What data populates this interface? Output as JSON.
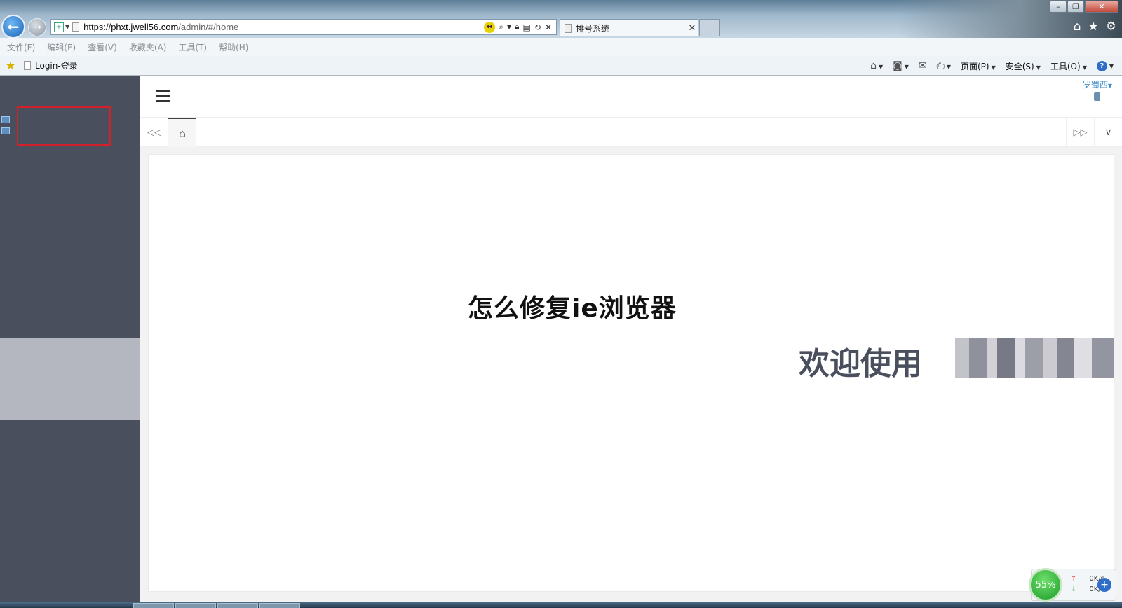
{
  "window": {
    "minimize_glyph": "–",
    "restore_glyph": "❐",
    "close_glyph": "✕"
  },
  "browser": {
    "back_glyph": "←",
    "forward_glyph": "→",
    "address": {
      "scheme": "https://",
      "host": "phxt.jwell56.com",
      "path": "/admin/#/home"
    },
    "tab_title": "排号系统",
    "tab_close_glyph": "✕",
    "right_icons": [
      "home-icon",
      "star-icon",
      "gear-icon"
    ]
  },
  "menubar": {
    "items": [
      "文件(F)",
      "编辑(E)",
      "查看(V)",
      "收藏夹(A)",
      "工具(T)",
      "帮助(H)"
    ]
  },
  "cmdbar": {
    "favorite_link": "Login-登录",
    "page_label": "页面(P)",
    "safety_label": "安全(S)",
    "tools_label": "工具(O)"
  },
  "app": {
    "user_name": "罗蜀西",
    "overlay_title": "怎么修复ie浏览器",
    "welcome_text": "欢迎使用"
  },
  "speed_widget": {
    "percent": "55%",
    "upload": "0K/s",
    "download": "0K/s"
  }
}
